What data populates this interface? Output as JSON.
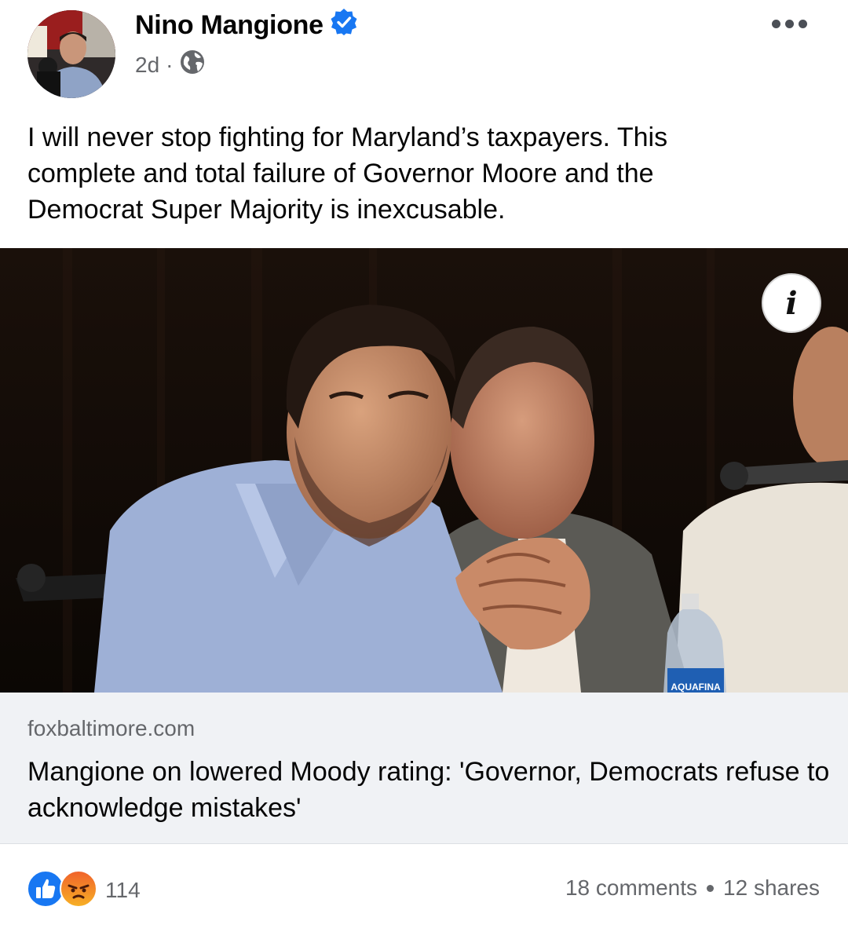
{
  "post": {
    "author": "Nino Mangione",
    "verified": true,
    "time": "2d",
    "separator": "·",
    "audience_icon": "globe-icon",
    "more_icon": "more-dots-icon",
    "text_lines": [
      "I will never stop fighting for Maryland’s taxpayers.  This",
      "complete and total failure of Governor Moore and the",
      "Democrat Super Majority is inexcusable."
    ]
  },
  "photo": {
    "info_label": "i",
    "bottle_label": "AQUAFINA"
  },
  "link": {
    "domain": "foxbaltimore.com",
    "title_lines": [
      "Mangione on lowered Moody rating: 'Governor, Democrats refuse to",
      "acknowledge mistakes'"
    ]
  },
  "engagement": {
    "reaction_icons": [
      "like-icon",
      "angry-icon"
    ],
    "reaction_count": "114",
    "comments": "18 comments",
    "shares": "12 shares"
  },
  "colors": {
    "verified_blue": "#1877f2",
    "secondary_text": "#65676b",
    "card_bg": "#f0f2f5",
    "angry_orange": "#f0612b"
  }
}
